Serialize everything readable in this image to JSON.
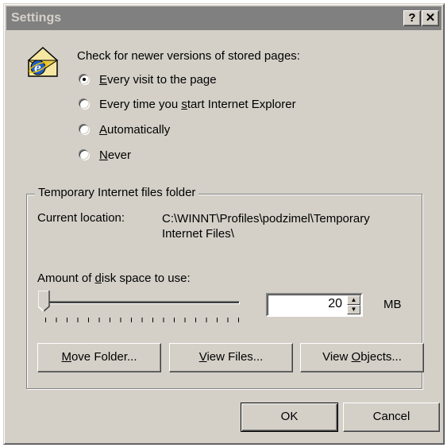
{
  "window": {
    "title": "Settings",
    "help_label": "?",
    "close_label": "✕"
  },
  "check_section": {
    "heading": "Check for newer versions of stored pages:",
    "options": [
      {
        "label": "Every visit to the page",
        "mnemonic": "E",
        "rest": "very visit to the page",
        "selected": true
      },
      {
        "label": "Every time you start Internet Explorer",
        "pre": "Every time you ",
        "mnemonic": "s",
        "rest": "tart Internet Explorer",
        "selected": false
      },
      {
        "label": "Automatically",
        "mnemonic": "A",
        "rest": "utomatically",
        "selected": false
      },
      {
        "label": "Never",
        "mnemonic": "N",
        "rest": "ever",
        "selected": false
      }
    ]
  },
  "temp_folder": {
    "group_label": "Temporary Internet files folder",
    "current_location_label": "Current location:",
    "current_location_line1": "C:\\WINNT\\Profiles\\podzimel\\Temporary",
    "current_location_line2": "Internet Files\\",
    "disk_label_pre": "Amount of ",
    "disk_label_mnemonic": "d",
    "disk_label_rest": "isk space to use:",
    "disk_space_value": "20",
    "disk_space_unit": "MB",
    "slider_position": 0
  },
  "buttons": {
    "move_folder": {
      "mnemonic": "M",
      "rest": "ove Folder..."
    },
    "view_files": {
      "mnemonic": "V",
      "rest": "iew Files..."
    },
    "view_objects": {
      "pre": "View ",
      "mnemonic": "O",
      "rest": "bjects..."
    },
    "ok": "OK",
    "cancel": "Cancel"
  },
  "colors": {
    "face": "#d4d0c8",
    "titlebar_inactive": "#808080",
    "titlebar_text": "#d4d0c8"
  },
  "icons": {
    "dialog": "ie-settings-icon",
    "help": "help-icon",
    "close": "close-icon"
  }
}
